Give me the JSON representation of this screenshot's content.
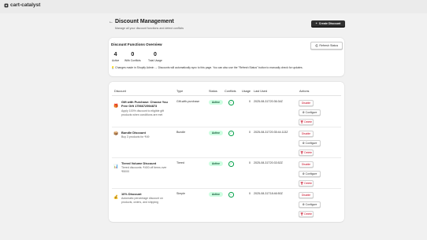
{
  "app": {
    "name": "cart-catalyst"
  },
  "header": {
    "back_glyph": "←",
    "title": "Discount Management",
    "subtitle": "Manage all your discount functions and detect conflicts",
    "create_label": "Create Discount",
    "create_glyph": "+"
  },
  "overview": {
    "title": "Discount Functions Overview",
    "refresh_label": "Refresh Status",
    "stats": [
      {
        "value": "4",
        "label": "Active"
      },
      {
        "value": "0",
        "label": "With Conflicts"
      },
      {
        "value": "0",
        "label": "Total Usage"
      }
    ],
    "notice": "💡 Changes made in Shopify Admin → Discounts will automatically sync to this page. You can also use the \"Refresh Status\" button to manually check for updates."
  },
  "table": {
    "headers": {
      "discount": "Discount",
      "type": "Type",
      "status": "Status",
      "conflicts": "Conflicts",
      "usage": "Usage",
      "last_used": "Last Used",
      "actions": "Actions"
    },
    "action_labels": {
      "disable": "Disable",
      "configure": "Configure",
      "delete": "Delete"
    },
    "rows": [
      {
        "icon": "🎁",
        "name": "Gift with Purchase: Choose You Free Gift 1756672594873",
        "description": "Apply 100% discount to eligible gift products when conditions are met",
        "type": "Gift-with-purchase",
        "status": "Active",
        "conflict": "✓",
        "usage": "0",
        "last_used": "2025-08-31T20:36:34Z"
      },
      {
        "icon": "📦",
        "name": "Bundle Discount",
        "description": "Buy 3 products for ₹49",
        "type": "Bundle",
        "status": "Active",
        "conflict": "✓",
        "usage": "0",
        "last_used": "2025-08-31T20:35:44.113Z"
      },
      {
        "icon": "📊",
        "name": "Tiered Volume Discount",
        "description": "Tiered discounts: ₹400 off items over ₹5000",
        "type": "Tiered",
        "status": "Active",
        "conflict": "✓",
        "usage": "0",
        "last_used": "2025-08-31T20:33:52Z"
      },
      {
        "icon": "💰",
        "name": "10% Discount",
        "description": "Automatic percentage discount on products, orders, and shipping",
        "type": "Simple",
        "status": "Active",
        "conflict": "✓",
        "usage": "0",
        "last_used": "2025-08-31T18:46:50Z"
      }
    ]
  }
}
